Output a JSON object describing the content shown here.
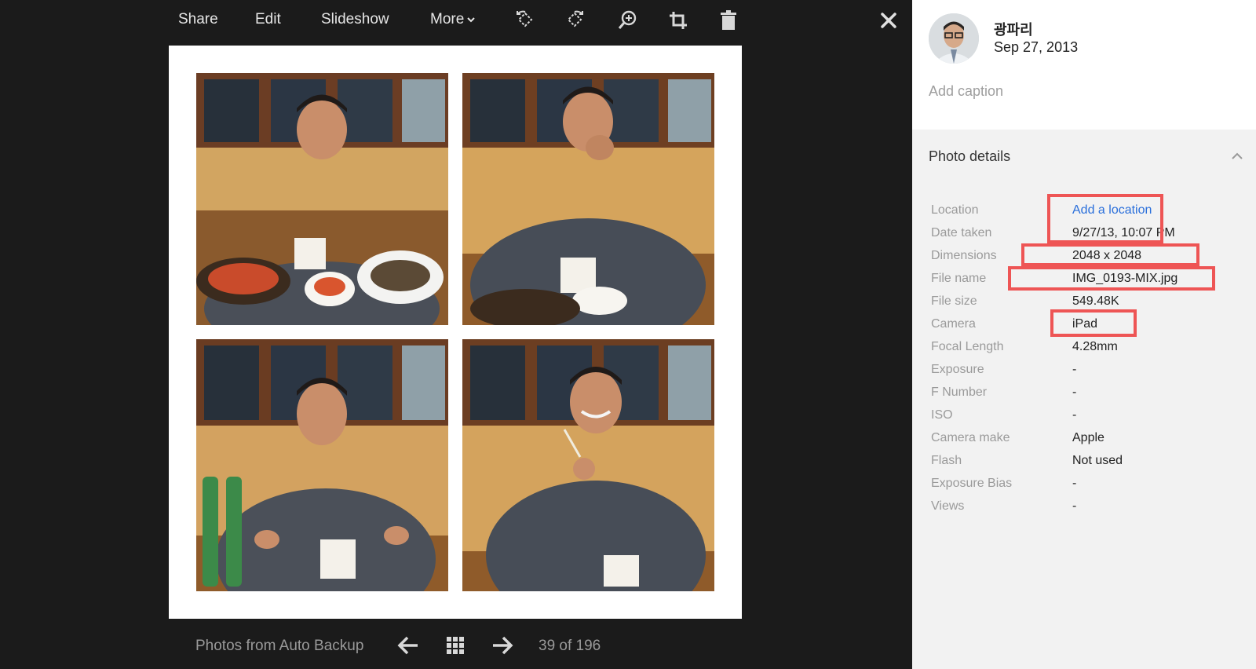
{
  "toolbar": {
    "share": "Share",
    "edit": "Edit",
    "slideshow": "Slideshow",
    "more": "More"
  },
  "icons": {
    "rotate_left": "rotate-left-icon",
    "rotate_right": "rotate-right-icon",
    "zoom": "zoom-in-icon",
    "crop": "crop-icon",
    "delete": "trash-icon",
    "close": "close-icon"
  },
  "bottom": {
    "album": "Photos from Auto Backup",
    "counter": "39 of 196"
  },
  "owner": {
    "name": "광파리",
    "date": "Sep 27, 2013"
  },
  "caption_placeholder": "Add caption",
  "details": {
    "header": "Photo details",
    "rows": [
      {
        "label": "Location",
        "value": "Add a location"
      },
      {
        "label": "Date taken",
        "value": "9/27/13, 10:07 PM"
      },
      {
        "label": "Dimensions",
        "value": "2048 x 2048"
      },
      {
        "label": "File name",
        "value": "IMG_0193-MIX.jpg"
      },
      {
        "label": "File size",
        "value": "549.48K"
      },
      {
        "label": "Camera",
        "value": "iPad"
      },
      {
        "label": "Focal Length",
        "value": "4.28mm"
      },
      {
        "label": "Exposure",
        "value": "-"
      },
      {
        "label": "F Number",
        "value": "-"
      },
      {
        "label": "ISO",
        "value": "-"
      },
      {
        "label": "Camera make",
        "value": "Apple"
      },
      {
        "label": "Flash",
        "value": "Not used"
      },
      {
        "label": "Exposure Bias",
        "value": "-"
      },
      {
        "label": "Views",
        "value": "-"
      }
    ]
  },
  "colors": {
    "background": "#1b1b1b",
    "panel": "#f2f2f2",
    "link": "#2a6fdb",
    "highlight": "#ee5555"
  }
}
